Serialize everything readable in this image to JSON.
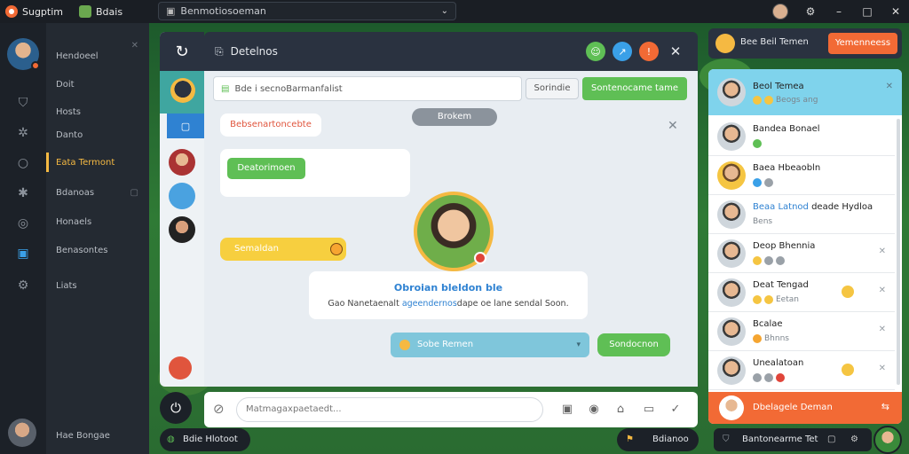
{
  "titlebar": {
    "app_name": "Sugptim",
    "tab_name": "Bdais",
    "selector_value": "Benmotiosoeman"
  },
  "nav": {
    "items": [
      {
        "label": "Hendoeel",
        "icon": "video-icon",
        "active": false
      },
      {
        "label": "Doit",
        "icon": "shield-icon",
        "active": false
      },
      {
        "label": "Hosts",
        "icon": "gear-icon",
        "active": false
      },
      {
        "label": "Danto",
        "icon": "circle-icon",
        "active": false
      },
      {
        "label": "Eata Termont",
        "icon": "settings-icon",
        "active": true
      },
      {
        "label": "Bdanoas",
        "icon": "chat-icon",
        "active": false
      },
      {
        "label": "Honaels",
        "icon": "box-icon",
        "active": false
      },
      {
        "label": "Benasontes",
        "icon": "stack-icon",
        "active": false
      },
      {
        "label": "Liats",
        "icon": "cog-icon",
        "active": false
      }
    ],
    "footer_label": "Hae Bongae"
  },
  "chat": {
    "title": "Detelnos",
    "search_text": "Bde i secnoBarmanfalist",
    "secondary_button": "Sorindie",
    "primary_button": "Sontenocame tame",
    "date_chip": "Brokem",
    "messages": {
      "red_note": "Bebsenartoncebte",
      "green_card_label": "Deatorimoen",
      "yellow_note": "Semaldan",
      "profile_title": "Obroian bleldon ble",
      "profile_subtitle_pre": "Gao Nanetaenalt ",
      "profile_subtitle_link": "ageendernos",
      "profile_subtitle_post": "dape oe lane sendal Soon.",
      "blue_select": "Sobe Remen",
      "green_reply": "Sondocnon"
    },
    "composer_placeholder": "Matmagaxpaetaedt..."
  },
  "contacts": {
    "header_title": "Bee Beil Temen",
    "header_button": "Yemenneess",
    "top_contact": {
      "name": "Beol Temea",
      "sub": "Beogs ang"
    },
    "items": [
      {
        "name": "Bandea Bonael",
        "sub": ""
      },
      {
        "name": "Baea Hbeaobln",
        "sub": ""
      },
      {
        "name": "Beaa Latnod",
        "name_suffix": "deade Hydloa",
        "sub": "Bens"
      },
      {
        "name": "Deop Bhennia",
        "sub": ""
      },
      {
        "name": "Deat Tengad",
        "sub": "Eetan"
      },
      {
        "name": "Bcalae",
        "sub": "Bhnns"
      },
      {
        "name": "Unealatoan",
        "sub": ""
      }
    ],
    "footer_label": "Dbelagele Deman"
  },
  "bottom": {
    "left_pill": "Bdie Hlotoot",
    "mid_pill": "Bdianoo",
    "right_pill": "Bantonearme Tet"
  },
  "colors": {
    "accent_orange": "#f26a35",
    "accent_green": "#5fbf55",
    "accent_blue": "#2f82d2",
    "accent_yellow": "#f5b942"
  }
}
